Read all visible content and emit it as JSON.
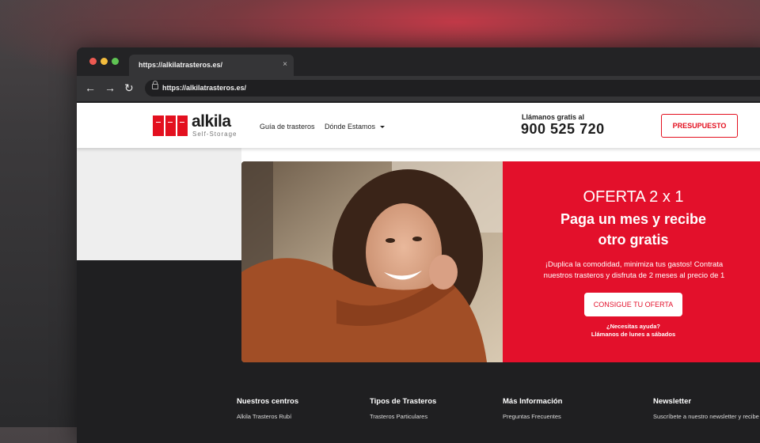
{
  "browser": {
    "tab_title": "https://alkilatrasteros.es/",
    "tab_close": "×",
    "url": "https://alkilatrasteros.es/",
    "nav": {
      "back": "←",
      "forward": "→",
      "reload": "↻"
    }
  },
  "header": {
    "logo_text": "alkila",
    "logo_sub": "Self-Storage",
    "menu": [
      {
        "label": "Guía de trasteros"
      },
      {
        "label": "Dónde Estamos"
      }
    ],
    "call_label": "Llámanos gratis al",
    "call_number": "900 525 720",
    "cta_label": "PRESUPUESTO"
  },
  "hero": {
    "title": "OFERTA 2 x 1",
    "headline_line1": "Paga un mes y recibe",
    "headline_line2": "otro gratis",
    "body": "¡Duplica la comodidad, minimiza tus gastos! Contrata nuestros trasteros y disfruta de 2 meses al precio de 1",
    "button_label": "CONSIGUE TU OFERTA",
    "help_line1": "¿Necesitas ayuda?",
    "help_line2": "Llámanos de lunes a sábados"
  },
  "footer": {
    "columns": [
      {
        "title": "Nuestros centros",
        "item": "Alkila Trasteros Rubí"
      },
      {
        "title": "Tipos de Trasteros",
        "item": "Trasteros Particulares"
      },
      {
        "title": "Más Información",
        "item": "Preguntas Frecuentes"
      },
      {
        "title": "Newsletter",
        "item": "Suscríbete a nuestro newsletter y recibe"
      }
    ]
  },
  "colors": {
    "brand_red": "#e3101f",
    "promo_red": "#e3102b",
    "dark": "#1f1f21"
  }
}
